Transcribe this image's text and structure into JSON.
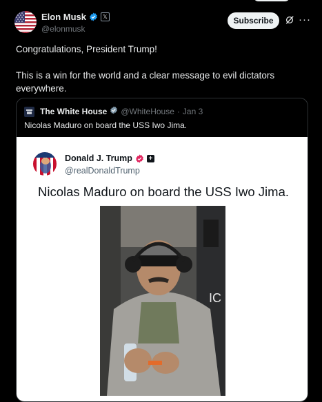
{
  "tweet": {
    "author_name": "Elon Musk",
    "author_handle": "@elonmusk",
    "x_badge": "𝕏",
    "subscribe_label": "Subscribe",
    "more_label": "···",
    "text_line1": "Congratulations, President Trump!",
    "text_line2": "This is a win for the world and a clear message to evil dictators everywhere."
  },
  "quote": {
    "author_name": "The White House",
    "author_handle": "@WhiteHouse",
    "separator": "·",
    "date": "Jan 3",
    "text": "Nicolas Maduro on board the USS Iwo Jima."
  },
  "embedded_post": {
    "author_name": "Donald J. Trump",
    "author_handle": "@realDonaldTrump",
    "plus_badge": "+",
    "text": "Nicolas Maduro on board the USS Iwo Jima."
  },
  "colors": {
    "background": "#000000",
    "text": "#e7e9ea",
    "muted": "#71767b",
    "verified_blue": "#1d9bf0",
    "verified_pink": "#e0245e",
    "button_bg": "#eff3f4"
  }
}
